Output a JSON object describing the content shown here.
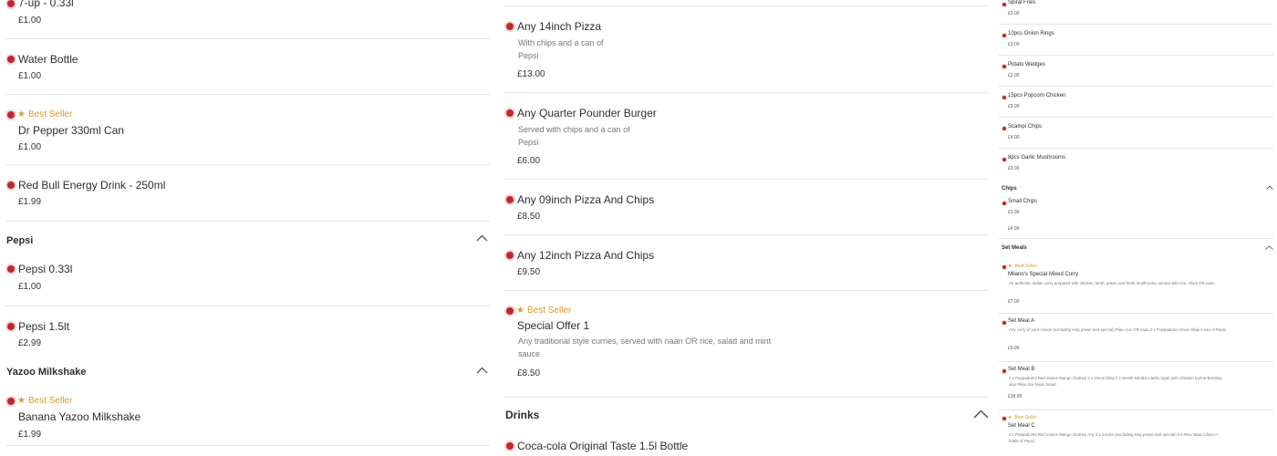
{
  "col1": {
    "items": [
      {
        "name": "7-up - 0.33l",
        "price": "£1.00"
      },
      {
        "name": "Water Bottle",
        "price": "£1.00"
      },
      {
        "badge": "Best Seller",
        "name": "Dr Pepper 330ml Can",
        "price": "£1.00"
      },
      {
        "name": "Red Bull Energy Drink - 250ml",
        "price": "£1.99"
      }
    ],
    "section_pepsi": "Pepsi",
    "pepsi_items": [
      {
        "name": "Pepsi 0.33l",
        "price": "£1.00"
      },
      {
        "name": "Pepsi 1.5lt",
        "price": "£2.99"
      }
    ],
    "section_yazoo": "Yazoo Milkshake",
    "yazoo_items": [
      {
        "badge": "Best Seller",
        "name": "Banana Yazoo Milkshake",
        "price": "£1.99"
      }
    ]
  },
  "col2": {
    "items": [
      {
        "name": "Any 14inch Pizza",
        "desc": "With chips and a can of Pepsi",
        "price": "£13.00"
      },
      {
        "name": "Any Quarter Pounder Burger",
        "desc": "Served with chips and a can of Pepsi",
        "price": "£6.00"
      },
      {
        "name": "Any 09inch Pizza And Chips",
        "price": "£8.50"
      },
      {
        "name": "Any 12inch Pizza And Chips",
        "price": "£9.50"
      },
      {
        "badge": "Best Seller",
        "name": "Special Offer 1",
        "desc": "Any traditional style curries, served with naan OR rice, salad and mint sauce",
        "price": "£8.50"
      }
    ],
    "section_drinks": "Drinks",
    "drinks_items": [
      {
        "name": "Coca-cola Original Taste 1.5l Bottle"
      }
    ]
  },
  "col3": {
    "items": [
      {
        "name": "Spiral Fries",
        "price": "£3.00"
      },
      {
        "name": "10pcs Onion Rings",
        "price": "£3.00"
      },
      {
        "name": "Potato Wedges",
        "price": "£2.00"
      },
      {
        "name": "15pcs Popcorn Chicken",
        "price": "£3.99"
      },
      {
        "name": "Scampi Chips",
        "price": "£4.00"
      },
      {
        "name": "8pcs Garlic Mushrooms",
        "price": "£3.00"
      }
    ],
    "section_chips": "Chips",
    "chips_items": [
      {
        "name": "Small Chips",
        "price": "£1.99",
        "price2": "£4.99"
      }
    ],
    "section_setmeals": "Set Meals",
    "setmeal_items": [
      {
        "badge": "Best Seller",
        "name": "Milano's Special Mixed Curry",
        "desc": "An authentic Indian curry prepared with chicken, lamb, prawn and fresh mushrooms served with rice, chips OR naan",
        "price": "£7.00"
      },
      {
        "name": "Set Meal A",
        "desc": "Any curry of your choice (excluding king prawn and special) Pilau rice OR naan 2 x Poppadoms Onion bhaji A can of Pepsi",
        "price": "£9.99"
      },
      {
        "name": "Set Meal B",
        "desc": "2 x Poppadoms Red onions Mango chutney 2 x Onion bhaji 2 x Seekh kebabs Lamb rogan josh Chicken korma Bombay aloo Pilau rice Naan bread",
        "price": "£18.99"
      },
      {
        "badge": "Best Seller",
        "name": "Set Meal C",
        "desc": "3 x Poppadoms Red onions Mango chutney Any 3 x curries (excluding king prawn and special) 3 x Rice Naan Chips A bottle of Pepsi"
      }
    ]
  },
  "colors": {
    "accent": "#c0272d",
    "badge": "#d99a2b",
    "divider": "#e6e6e6"
  }
}
